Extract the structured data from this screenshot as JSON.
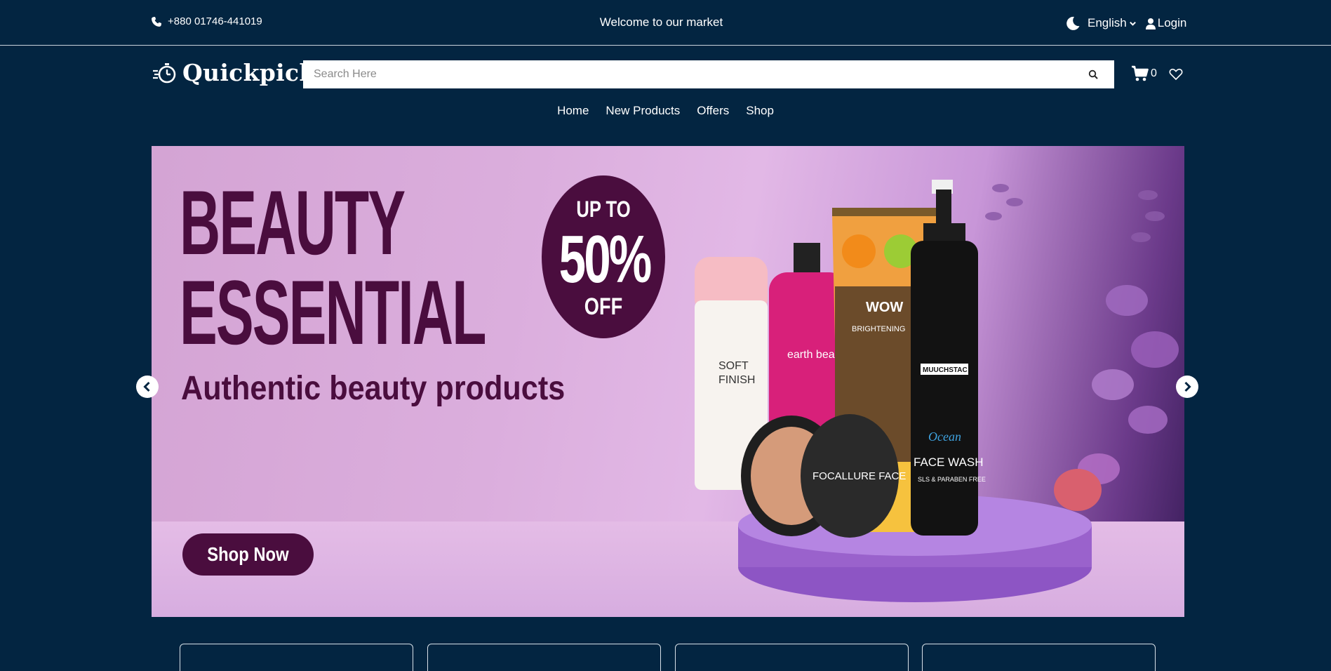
{
  "topbar": {
    "phone": "+880 01746-441019",
    "welcome": "Welcome to our market",
    "language": "English",
    "login": "Login"
  },
  "header": {
    "brand": "Quickpick",
    "search_placeholder": "Search Here",
    "cart_count": "0"
  },
  "nav": {
    "items": [
      "Home",
      "New Products",
      "Offers",
      "Shop"
    ]
  },
  "banner": {
    "headline_line1": "BEAUTY",
    "headline_line2": "ESSENTIAL",
    "subtitle": "Authentic beauty products",
    "badge_line1": "UP TO",
    "badge_line2": "50%",
    "badge_line3": "OFF",
    "cta": "Shop Now",
    "product_labels": {
      "bottle1_line1": "SOFT",
      "bottle1_line2": "FINISH",
      "bottle2": "earth beauty & you",
      "tube_brand": "WOW",
      "tube_line": "BRIGHTENING",
      "compact": "FOCALLURE FACE",
      "pump_brand": "MUUCHSTAC",
      "pump_sub": "Ocean",
      "pump_name": "FACE WASH",
      "pump_note": "SLS & PARABEN FREE"
    }
  },
  "colors": {
    "background": "#032541",
    "banner_accent": "#4a0d3e"
  }
}
